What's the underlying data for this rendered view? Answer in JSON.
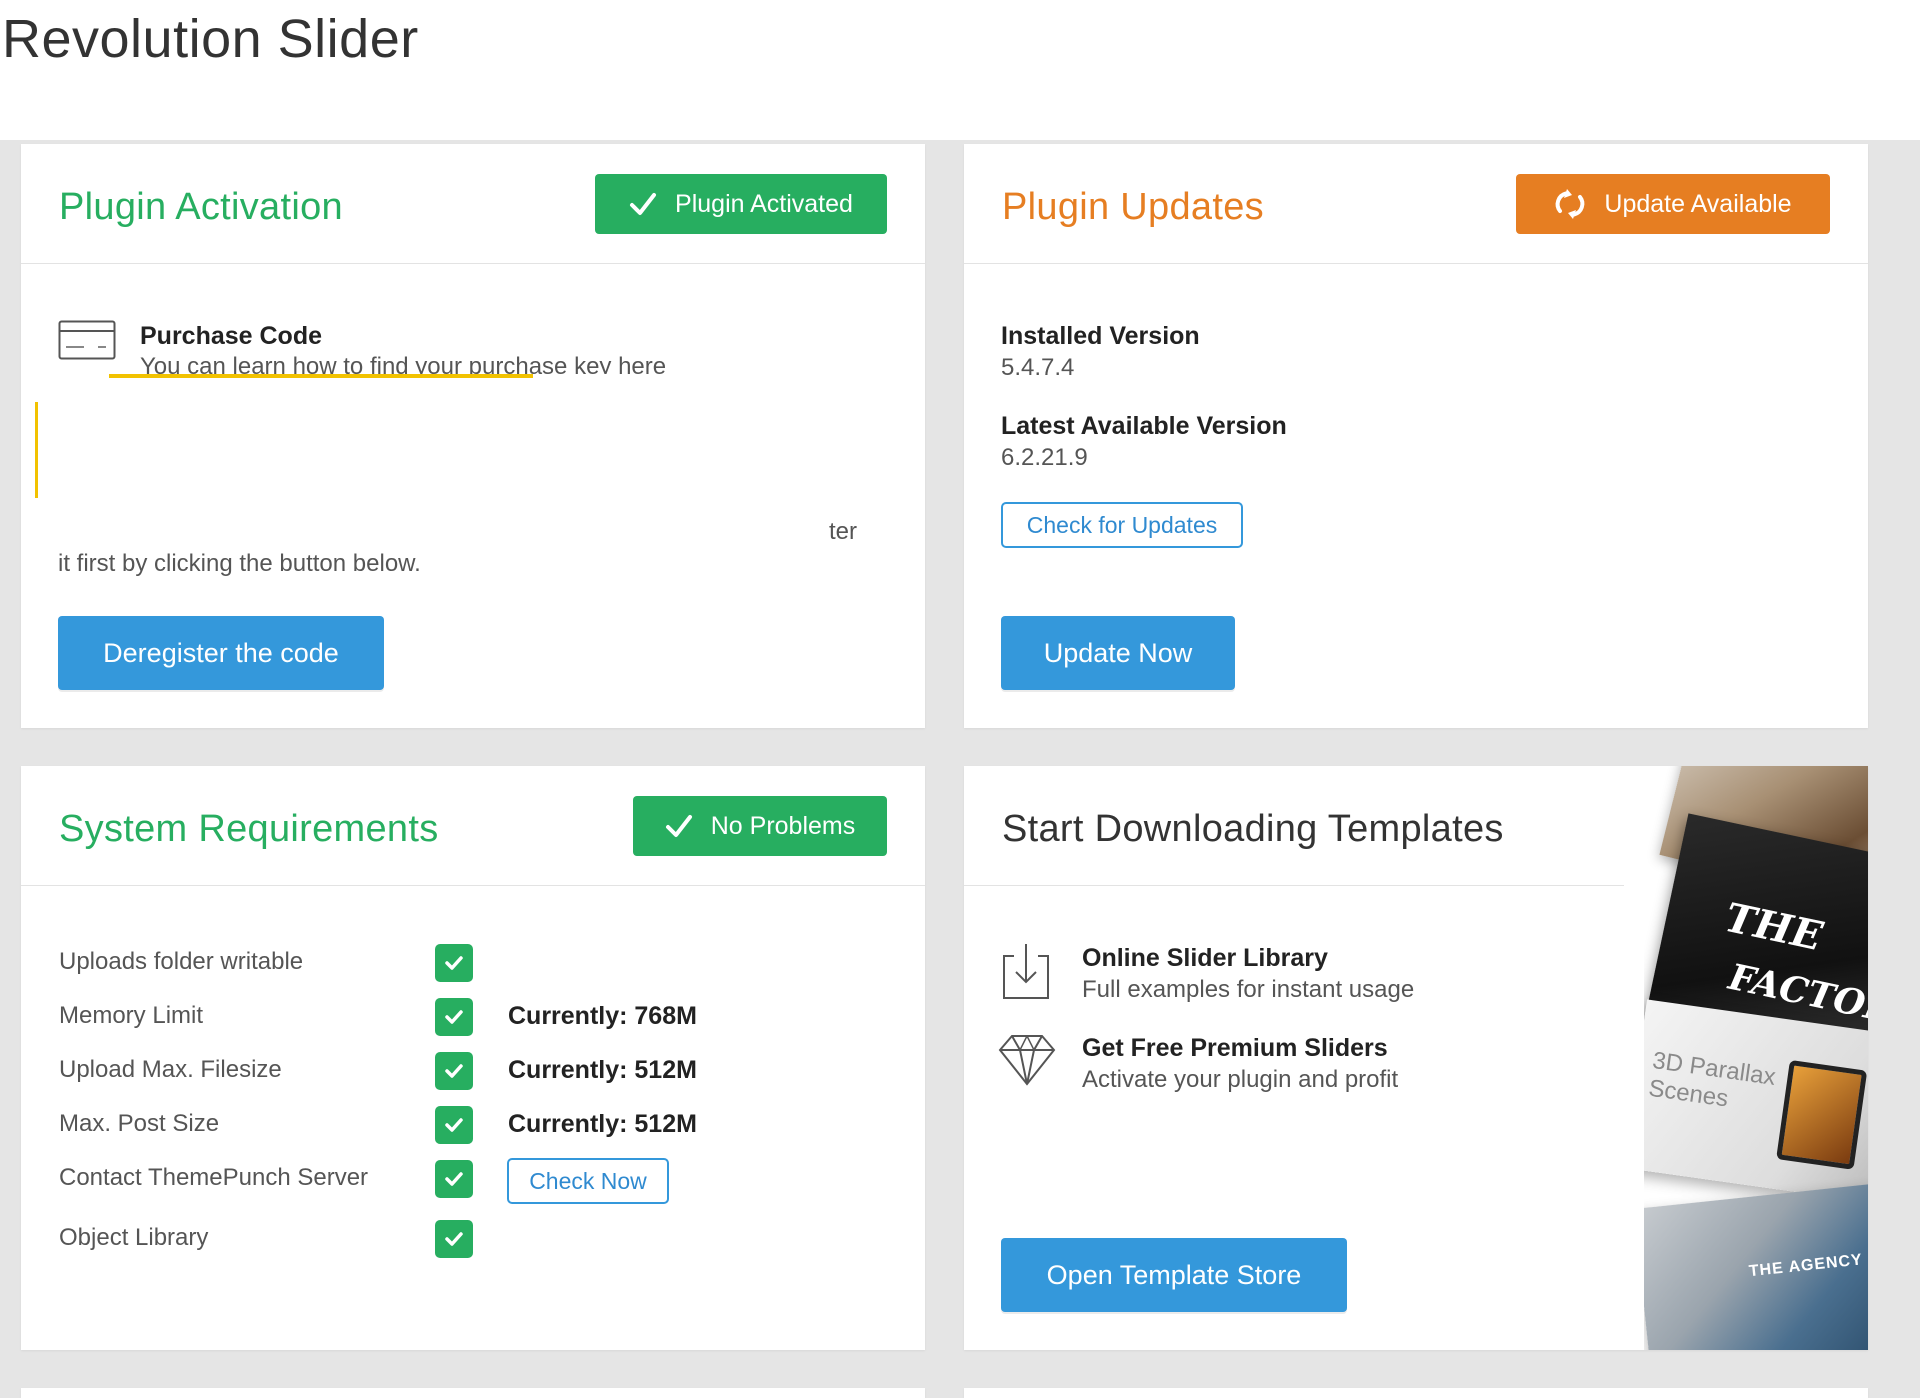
{
  "page": {
    "title": "Revolution Slider"
  },
  "activation": {
    "title": "Plugin Activation",
    "badge": "Plugin Activated",
    "purchase_label": "Purchase Code",
    "purchase_hint": "You can learn how to find your purchase key here",
    "fragment": "ter",
    "deregister_note": "it first by clicking the button below.",
    "deregister_button": "Deregister the code"
  },
  "updates": {
    "title": "Plugin Updates",
    "badge": "Update Available",
    "installed_label": "Installed Version",
    "installed_value": "5.4.7.4",
    "latest_label": "Latest Available Version",
    "latest_value": "6.2.21.9",
    "check_button": "Check for Updates",
    "update_button": "Update Now"
  },
  "requirements": {
    "title": "System Requirements",
    "badge": "No Problems",
    "items": [
      {
        "label": "Uploads folder writable",
        "value": ""
      },
      {
        "label": "Memory Limit",
        "value": "Currently: 768M"
      },
      {
        "label": "Upload Max. Filesize",
        "value": "Currently: 512M"
      },
      {
        "label": "Max. Post Size",
        "value": "Currently: 512M"
      },
      {
        "label": "Contact ThemePunch Server",
        "value": ""
      },
      {
        "label": "Object Library",
        "value": ""
      }
    ],
    "check_now_button": "Check Now"
  },
  "templates": {
    "title": "Start Downloading Templates",
    "items": [
      {
        "title": "Online Slider Library",
        "subtitle": "Full examples for instant usage",
        "icon": "download-icon"
      },
      {
        "title": "Get Free Premium Sliders",
        "subtitle": "Activate your plugin and profit",
        "icon": "diamond-icon"
      }
    ],
    "store_button": "Open Template Store",
    "collage_texts": {
      "t1": "THE",
      "t2": "FACTOR",
      "t3": "3D Parallax",
      "t4": "Scenes",
      "t5": "THE AGENCY"
    }
  },
  "colors": {
    "green": "#27ae60",
    "orange": "#e67e22",
    "blue": "#3498db",
    "dark_heading": "#333333",
    "grey_bg": "#e5e5e5"
  }
}
